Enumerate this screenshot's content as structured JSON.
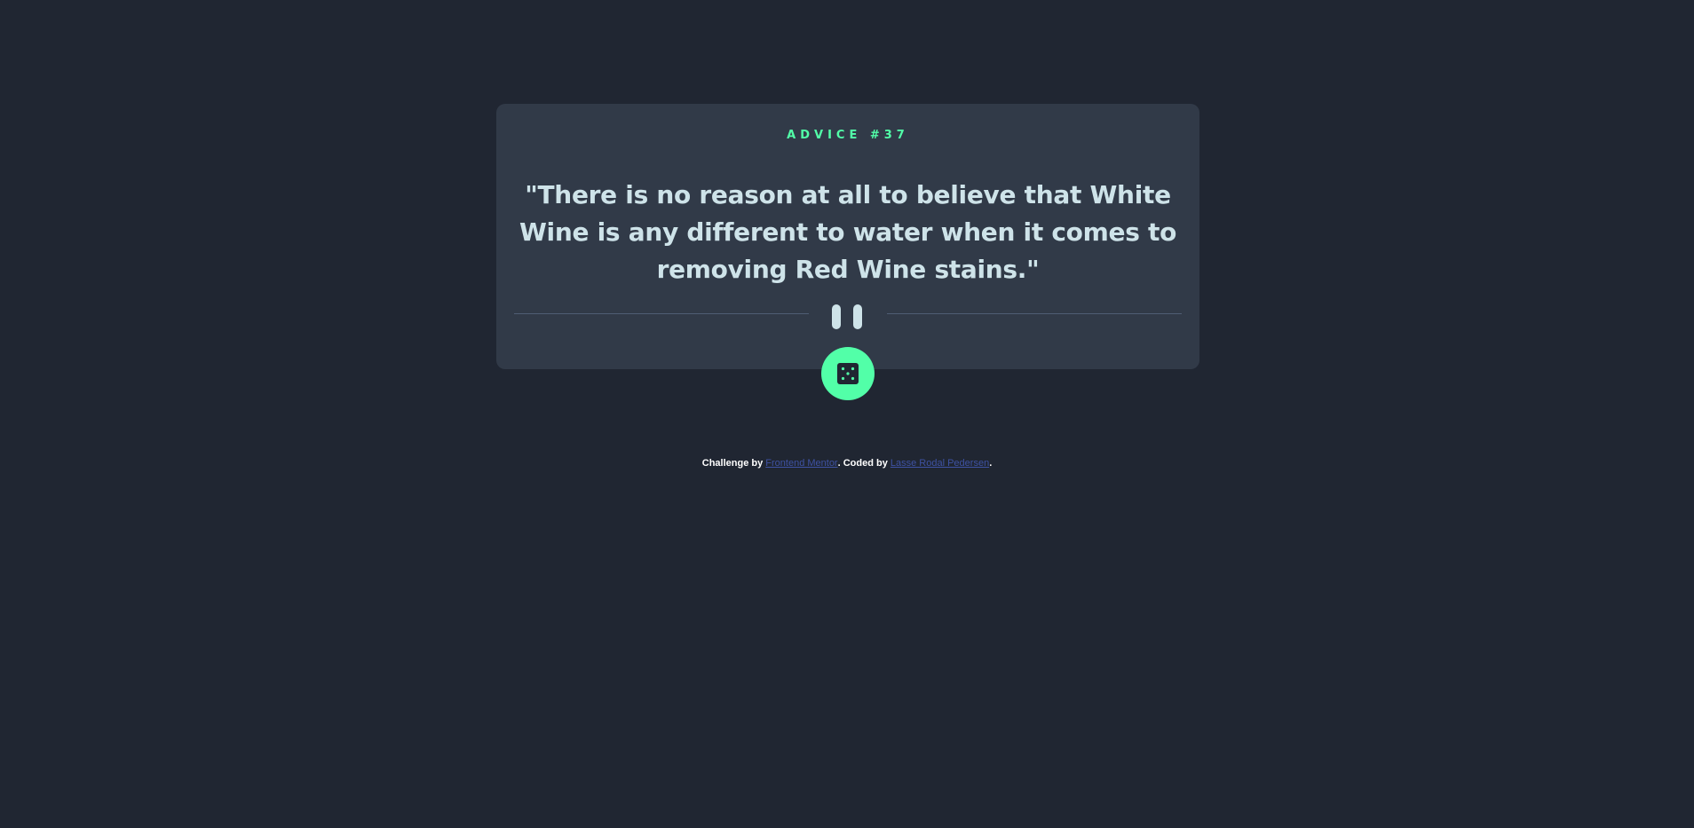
{
  "card": {
    "advice_label": "ADVICE #37",
    "quote": "\"There is no reason at all to believe that White Wine is any different to water when it comes to removing Red Wine stains.\""
  },
  "dice_button": {
    "icon": "dice-icon"
  },
  "footer": {
    "prefix": "Challenge by ",
    "frontend_mentor": "Frontend Mentor",
    "middle": ". Coded by ",
    "author": "Lasse Rodal Pedersen",
    "suffix": "."
  },
  "colors": {
    "background": "#202632",
    "card": "#313a48",
    "accent": "#52ffa8",
    "quote_text": "#cee3e9",
    "link": "#3e52a3"
  }
}
